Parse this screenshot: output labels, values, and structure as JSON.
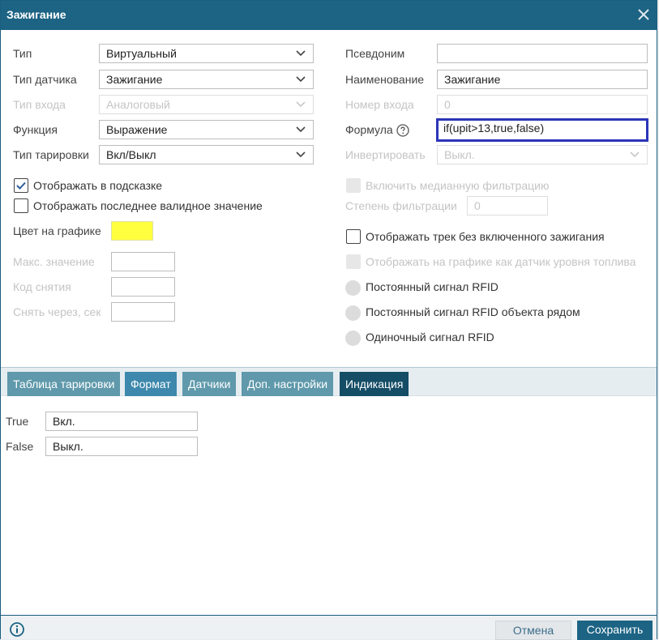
{
  "dialog": {
    "title": "Зажигание"
  },
  "left_fields": {
    "type": {
      "label": "Тип",
      "value": "Виртуальный"
    },
    "sensor_type": {
      "label": "Тип датчика",
      "value": "Зажигание"
    },
    "input_type": {
      "label": "Тип входа",
      "value": "Аналоговый"
    },
    "function": {
      "label": "Функция",
      "value": "Выражение"
    },
    "calibration_type": {
      "label": "Тип тарировки",
      "value": "Вкл/Выкл"
    }
  },
  "right_fields": {
    "alias": {
      "label": "Псевдоним",
      "value": ""
    },
    "name": {
      "label": "Наименование",
      "value": "Зажигание"
    },
    "input_number": {
      "label": "Номер входа",
      "value": "0"
    },
    "formula": {
      "label": "Формула",
      "value": "if(upit>13,true,false)"
    },
    "invert": {
      "label": "Инвертировать",
      "value": "Выкл."
    }
  },
  "checkboxes": {
    "show_in_tooltip": {
      "label": "Отображать в подсказке",
      "checked": true
    },
    "show_last_valid": {
      "label": "Отображать последнее валидное значение",
      "checked": false
    },
    "median_filter": {
      "label": "Включить медианную фильтрацию",
      "checked": false
    },
    "show_track_without_ignition": {
      "label": "Отображать трек без включенного зажигания",
      "checked": false
    },
    "show_as_fuel_sensor": {
      "label": "Отображать на графике как датчик уровня топлива",
      "checked": false
    }
  },
  "filter_degree": {
    "label": "Степень фильтрации",
    "value": "0"
  },
  "chart_color": {
    "label": "Цвет на графике",
    "color": "#ffff40"
  },
  "extra_fields": {
    "max_value": {
      "label": "Макс. значение",
      "value": ""
    },
    "removal_code": {
      "label": "Код снятия",
      "value": ""
    },
    "remove_after": {
      "label": "Снять через, сек",
      "value": ""
    }
  },
  "radios": {
    "rfid_constant": {
      "label": "Постоянный сигнал RFID"
    },
    "rfid_constant_nearby": {
      "label": "Постоянный сигнал RFID объекта рядом"
    },
    "rfid_single": {
      "label": "Одиночный сигнал RFID"
    }
  },
  "tabs": [
    {
      "label": "Таблица тарировки"
    },
    {
      "label": "Формат"
    },
    {
      "label": "Датчики"
    },
    {
      "label": "Доп. настройки"
    },
    {
      "label": "Индикация"
    }
  ],
  "indication": {
    "true": {
      "label": "True",
      "value": "Вкл."
    },
    "false": {
      "label": "False",
      "value": "Выкл."
    }
  },
  "footer": {
    "cancel_label": "Отмена",
    "save_label": "Сохранить"
  },
  "colors": {
    "header": "#1c6384",
    "active_tab": "#154d66",
    "focus_border": "#2b35b8",
    "swatch": "#ffff40"
  }
}
